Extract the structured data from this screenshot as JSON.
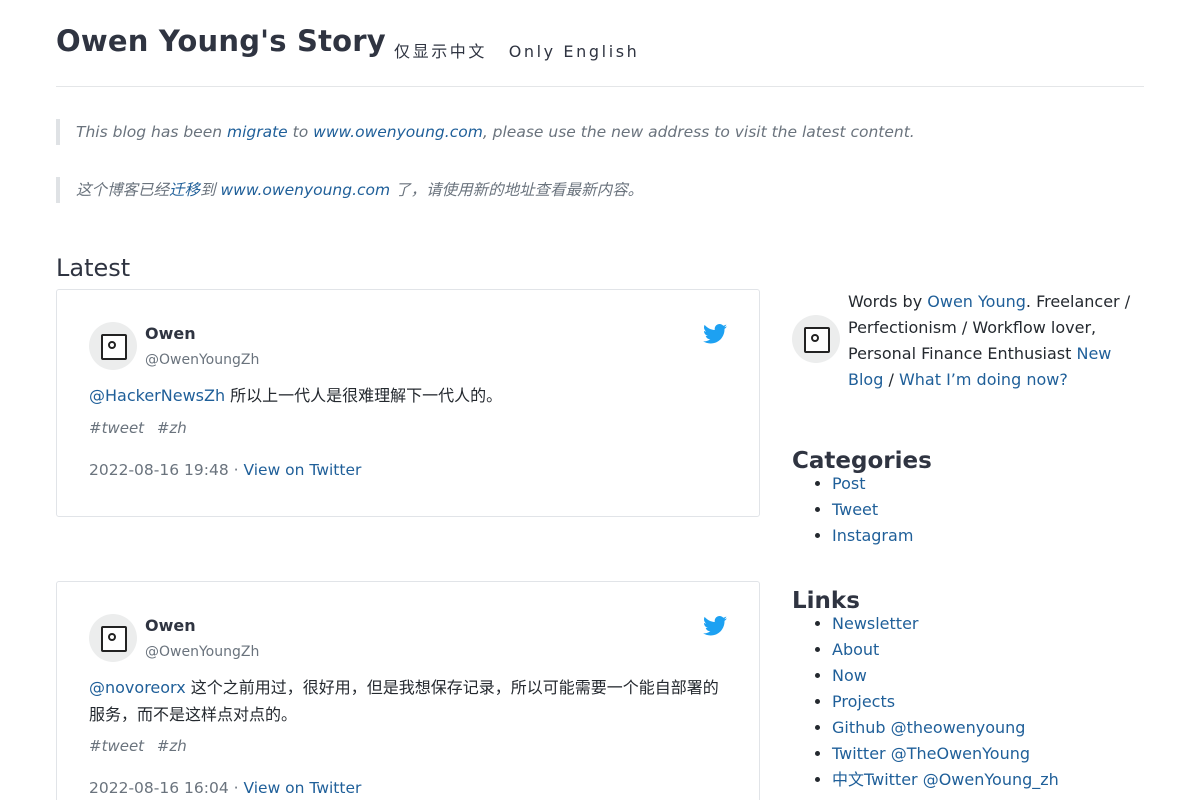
{
  "site": {
    "title": "Owen Young's Story",
    "lang_zh": "仅显示中文",
    "lang_en": "Only English"
  },
  "notice_en": {
    "prefix": "This blog has been ",
    "link1": "migrate",
    "middle": " to ",
    "link2": "www.owenyoung.com",
    "suffix": ", please use the new address to visit the latest content."
  },
  "notice_zh": {
    "prefix": "这个博客已经",
    "link1": "迁移",
    "middle": "到 ",
    "link2": "www.owenyoung.com",
    "suffix": " 了，请使用新的地址查看最新内容。"
  },
  "latest_heading": "Latest",
  "tweets": [
    {
      "author": "Owen",
      "handle": "@OwenYoungZh",
      "mention": "@HackerNewsZh",
      "text": " 所以上一代人是很难理解下一代人的。",
      "tags": [
        "#tweet",
        "#zh"
      ],
      "date": "2022-08-16 19:48",
      "separator": " · ",
      "view_link": "View on Twitter"
    },
    {
      "author": "Owen",
      "handle": "@OwenYoungZh",
      "mention": "@novoreorx",
      "text": " 这个之前用过，很好用，但是我想保存记录，所以可能需要一个能自部署的服务，而不是这样点对点的。",
      "tags": [
        "#tweet",
        "#zh"
      ],
      "date": "2022-08-16 16:04",
      "separator": " · ",
      "view_link": "View on Twitter"
    }
  ],
  "sidebar": {
    "bio_prefix": "Words by ",
    "bio_name": "Owen Young",
    "bio_middle": ". Freelancer / Perfectionism / Workflow lover, Personal Finance Enthusiast ",
    "bio_link1": "New Blog",
    "bio_sep": " / ",
    "bio_link2": "What I’m doing now?",
    "categories_heading": "Categories",
    "categories": [
      "Post",
      "Tweet",
      "Instagram"
    ],
    "links_heading": "Links",
    "links": [
      "Newsletter",
      "About",
      "Now",
      "Projects",
      "Github @theowenyoung",
      "Twitter @TheOwenYoung",
      "中文Twitter @OwenYoung_zh"
    ]
  },
  "colors": {
    "link": "#1f5f99",
    "twitter": "#1da1f2",
    "muted": "#6a737d"
  }
}
